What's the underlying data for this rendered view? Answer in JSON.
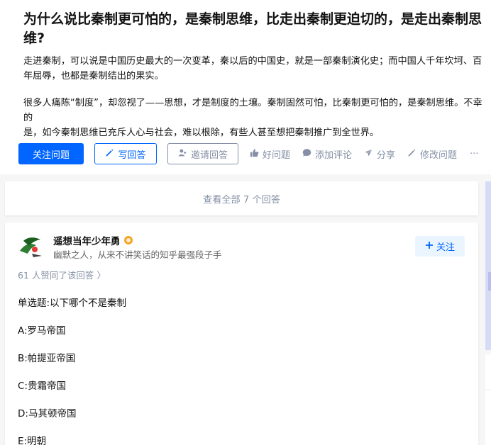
{
  "question": {
    "title": "为什么说比秦制更可怕的，是秦制思维，比走出秦制更迫切的，是走出秦制思维?",
    "detail_p1_line1": "走进秦制，可以说是中国历史最大的一次变革，秦以后的中国史，就是一部秦制演化史；而中国人千年坎坷、百",
    "detail_p1_line2": "年屈辱，也都是秦制结出的果实。",
    "detail_p2_line1": "很多人痛陈“制度”，却忽视了——思想，才是制度的土壤。秦制固然可怕，比秦制更可怕的，是秦制思维。不幸的",
    "detail_p2_line2": "是，如今秦制思维已充斥人心与社会，难以根除，有些人甚至想把秦制推广到全世界。"
  },
  "actions": {
    "follow": "关注问题",
    "write": "写回答",
    "invite": "邀请回答",
    "good": "好问题",
    "comment": "添加评论",
    "share": "分享",
    "edit": "修改问题",
    "more": "···"
  },
  "view_all": "查看全部 7 个回答",
  "answer": {
    "author_name": "遥想当年少年勇",
    "author_bio": "幽默之人，从来不讲笑话的知乎最强段子手",
    "follow": "关注",
    "voters": "61 人赞同了该回答 〉",
    "lines": [
      "单选题:以下哪个不是秦制",
      "A:罗马帝国",
      "B:帕提亚帝国",
      "C:贵霜帝国",
      "D:马其顿帝国",
      "E:明朝"
    ]
  },
  "colors": {
    "brand": "#0066ff",
    "muted": "#8590a6",
    "text": "#121212",
    "page_bg": "#f6f6f6"
  },
  "icons": [
    "pencil-icon",
    "invite-icon",
    "thumbs-up-icon",
    "comment-bubble-icon",
    "share-icon",
    "edit-pencil-icon",
    "plus-icon",
    "badge-icon"
  ]
}
